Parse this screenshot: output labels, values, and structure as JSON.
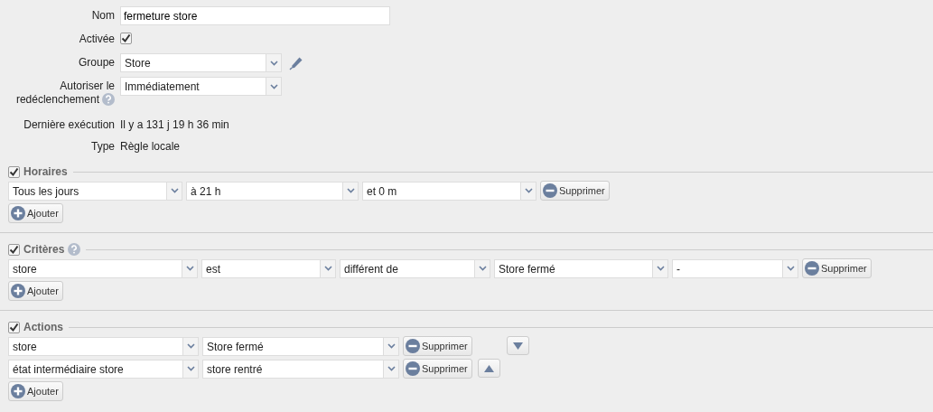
{
  "form": {
    "fields": [
      {
        "kind": "text",
        "label": "Nom",
        "value": "fermeture store"
      },
      {
        "kind": "checkbox",
        "label": "Activée",
        "checked": true
      },
      {
        "kind": "select",
        "label": "Groupe",
        "value": "Store",
        "editable": true
      },
      {
        "kind": "select",
        "label": "Autoriser le redéclenchement",
        "value": "Immédiatement",
        "help": true
      },
      {
        "kind": "info",
        "label": "Dernière exécution",
        "value": "Il y a 131 j 19 h 36 min"
      },
      {
        "kind": "info",
        "label": "Type",
        "value": "Règle locale"
      }
    ]
  },
  "sections": [
    {
      "title": "Horaires",
      "checked": true,
      "rows": [
        {
          "selects": [
            "Tous les jours",
            "à 21 h",
            "et 0 m"
          ],
          "remove_label": "Supprimer"
        }
      ],
      "add_label": "Ajouter"
    },
    {
      "title": "Critères",
      "checked": true,
      "help": true,
      "rows": [
        {
          "selects": [
            "store",
            "est",
            "différent de",
            "Store fermé",
            "-"
          ],
          "remove_label": "Supprimer"
        }
      ],
      "add_label": "Ajouter"
    },
    {
      "title": "Actions",
      "checked": true,
      "rows": [
        {
          "selects": [
            "store",
            "Store fermé"
          ],
          "remove_label": "Supprimer",
          "move_down": true
        },
        {
          "selects": [
            "état intermédiaire store",
            "store rentré"
          ],
          "remove_label": "Supprimer",
          "move_up": true
        }
      ],
      "add_label": "Ajouter"
    }
  ]
}
